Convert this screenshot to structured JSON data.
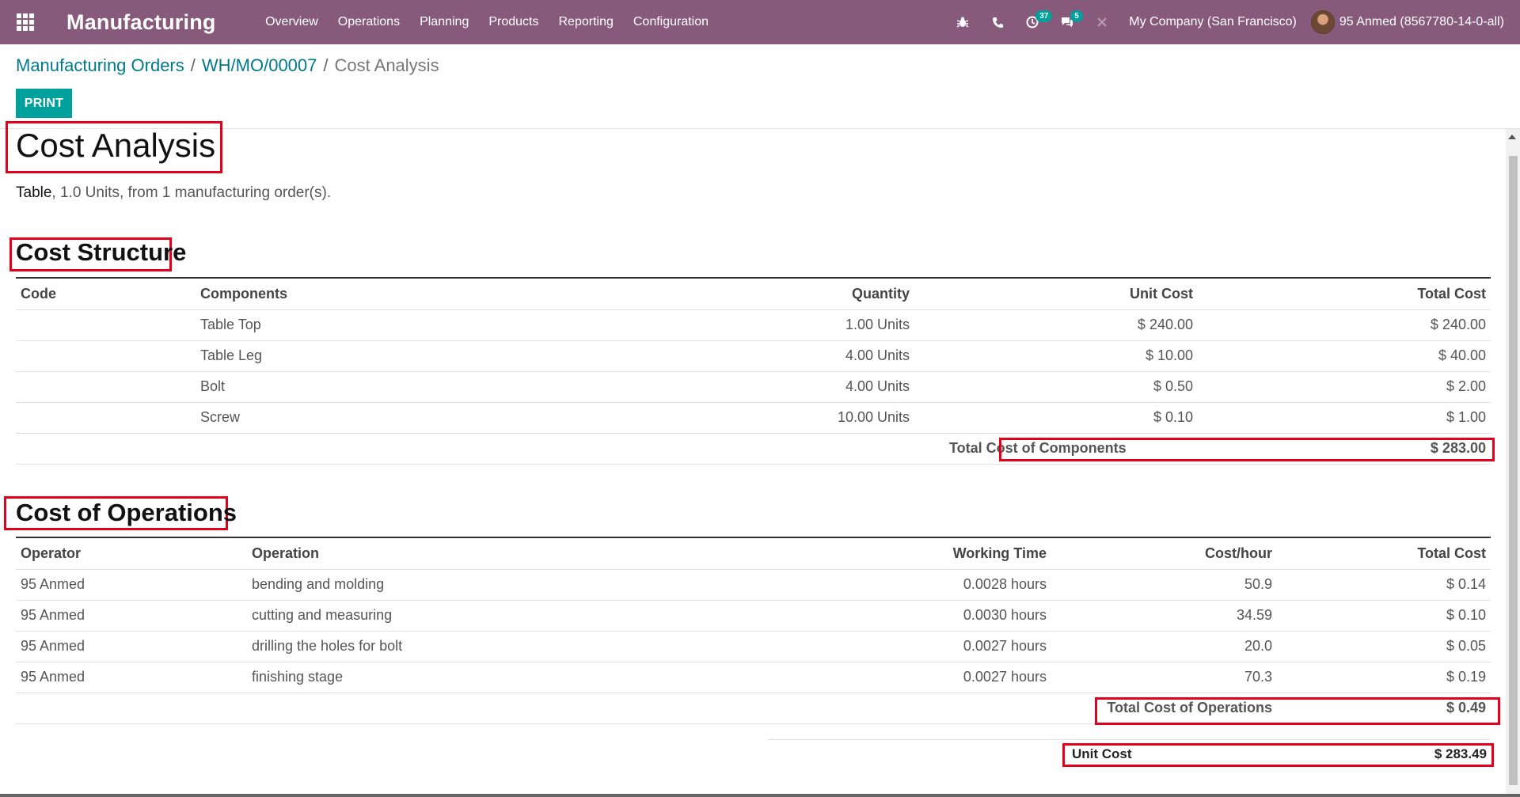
{
  "navbar": {
    "app_name": "Manufacturing",
    "menu": [
      "Overview",
      "Operations",
      "Planning",
      "Products",
      "Reporting",
      "Configuration"
    ],
    "icons": {
      "debug": "bug-icon",
      "phone": "phone-icon",
      "activity": "clock-icon",
      "messages": "chat-icon",
      "close": "close-icon"
    },
    "activity_count": "37",
    "message_count": "5",
    "company": "My Company (San Francisco)",
    "user": "95 Anmed (8567780-14-0-all)"
  },
  "breadcrumb": {
    "items": [
      "Manufacturing Orders",
      "WH/MO/00007"
    ],
    "separator": "/",
    "current": "Cost Analysis"
  },
  "buttons": {
    "print": "PRINT"
  },
  "report": {
    "title": "Cost Analysis",
    "product": "Table",
    "summary": ", 1.0 Units, from 1 manufacturing order(s)."
  },
  "cost_structure": {
    "heading": "Cost Structure",
    "columns": [
      "Code",
      "Components",
      "Quantity",
      "Unit Cost",
      "Total Cost"
    ],
    "rows": [
      {
        "code": "",
        "component": "Table Top",
        "quantity": "1.00 Units",
        "unit_cost": "$ 240.00",
        "total_cost": "$ 240.00"
      },
      {
        "code": "",
        "component": "Table Leg",
        "quantity": "4.00 Units",
        "unit_cost": "$ 10.00",
        "total_cost": "$ 40.00"
      },
      {
        "code": "",
        "component": "Bolt",
        "quantity": "4.00 Units",
        "unit_cost": "$ 0.50",
        "total_cost": "$ 2.00"
      },
      {
        "code": "",
        "component": "Screw",
        "quantity": "10.00 Units",
        "unit_cost": "$ 0.10",
        "total_cost": "$ 1.00"
      }
    ],
    "total_label": "Total Cost of Components",
    "total_value": "$ 283.00"
  },
  "cost_operations": {
    "heading": "Cost of Operations",
    "columns": [
      "Operator",
      "Operation",
      "Working Time",
      "Cost/hour",
      "Total Cost"
    ],
    "rows": [
      {
        "operator": "95 Anmed",
        "operation": "bending and molding",
        "time": "0.0028 hours",
        "rate": "50.9",
        "total": "$ 0.14"
      },
      {
        "operator": "95 Anmed",
        "operation": "cutting and measuring",
        "time": "0.0030 hours",
        "rate": "34.59",
        "total": "$ 0.10"
      },
      {
        "operator": "95 Anmed",
        "operation": "drilling the holes for bolt",
        "time": "0.0027 hours",
        "rate": "20.0",
        "total": "$ 0.05"
      },
      {
        "operator": "95 Anmed",
        "operation": "finishing stage",
        "time": "0.0027 hours",
        "rate": "70.3",
        "total": "$ 0.19"
      }
    ],
    "total_label": "Total Cost of Operations",
    "total_value": "$ 0.49"
  },
  "unit_cost": {
    "label": "Unit Cost",
    "value": "$ 283.49"
  },
  "colors": {
    "navbar": "#875a7b",
    "accent": "#00a09d",
    "link": "#00798a",
    "highlight": "#e2001a"
  }
}
